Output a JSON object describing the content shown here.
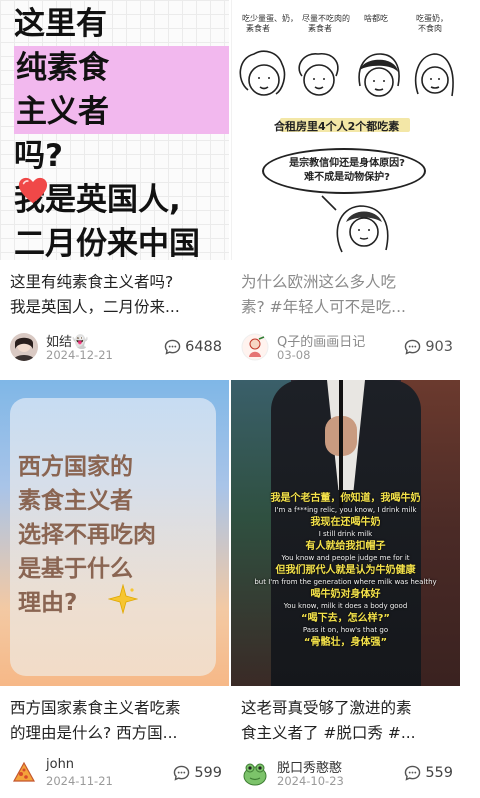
{
  "cards": [
    {
      "thumb": {
        "lines": [
          "这里有",
          "纯素食",
          "主义者",
          "吗?",
          "我是英国人,",
          "二月份来中国"
        ],
        "icon": "heart-icon",
        "heart_color": "#f04848"
      },
      "title": {
        "line1": "这里有纯素食主义者吗?",
        "line2": "我是英国人，二月份来..."
      },
      "author": "如结👻",
      "date": "2024-12-21",
      "comments": "6488"
    },
    {
      "thumb": {
        "notes": [
          "吃少量蛋、奶，",
          "素食者",
          "尽量不吃肉的",
          "素食者",
          "啥都吃",
          "吃蛋奶，",
          "不食肉"
        ],
        "caption": "合租房里4个人2个都吃素",
        "bubble_line1": "是宗教信仰还是身体原因?",
        "bubble_line2": "难不成是动物保护?"
      },
      "title": {
        "line1": "为什么欧洲这么多人吃",
        "line2": "素? #年轻人可不是吃..."
      },
      "author": "Q子的画画日记",
      "date": "03-08",
      "comments": "903"
    },
    {
      "thumb": {
        "lines": [
          "西方国家的",
          "素食主义者",
          "选择不再吃肉",
          "是基于什么",
          "理由?"
        ],
        "icon": "sparkle-icon"
      },
      "title": {
        "line1": "西方国家素食主义者吃素",
        "line2": "的理由是什么? 西方国..."
      },
      "author": "john",
      "date": "2024-11-21",
      "comments": "599"
    },
    {
      "thumb": {
        "subtitles": [
          {
            "zh": "我是个老古董，你知道，我喝牛奶",
            "en": "I'm a f***ing relic, you know, I drink milk"
          },
          {
            "zh": "我现在还喝牛奶",
            "en": "I still drink milk"
          },
          {
            "zh": "有人就给我扣帽子",
            "en": "You know and people judge me for it"
          },
          {
            "zh": "但我们那代人就是认为牛奶健康",
            "en": "but I'm from the generation where milk was healthy"
          },
          {
            "zh": "喝牛奶对身体好",
            "en": "You know, milk it does a body good"
          },
          {
            "zh": "“喝下去，怎么样?”",
            "en": "Pass it on, how's that go"
          },
          {
            "zh": "“骨骼壮，身体强”",
            "en": ""
          }
        ]
      },
      "title": {
        "line1": "这老哥真受够了激进的素",
        "line2": "食主义者了 #脱口秀 #..."
      },
      "author": "脱口秀憨憨",
      "date": "2024-10-23",
      "comments": "559"
    }
  ],
  "colors": {
    "highlight": "#f2b8ee",
    "poster_text": "#8a6552",
    "subtitle_zh": "#f4e24a"
  }
}
